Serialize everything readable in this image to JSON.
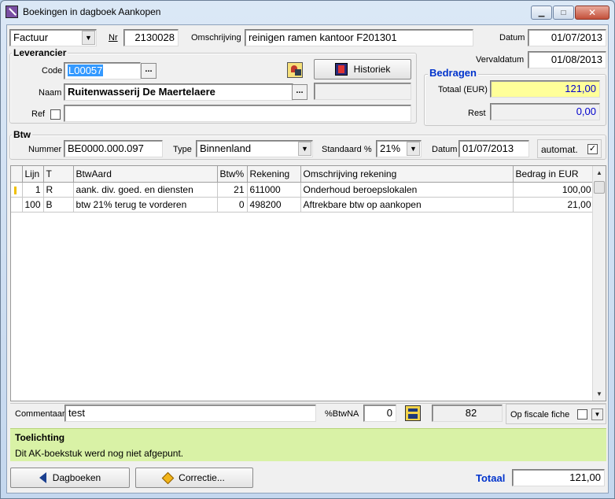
{
  "window": {
    "title": "Boekingen in dagboek Aankopen"
  },
  "header": {
    "doc_type": "Factuur",
    "nr_label": "Nr",
    "nr_value": "2130028",
    "omschrijving_label": "Omschrijving",
    "omschrijving_value": "reinigen ramen kantoor F201301",
    "datum_label": "Datum",
    "datum_value": "01/07/2013",
    "vervaldatum_label": "Vervaldatum",
    "vervaldatum_value": "01/08/2013"
  },
  "leverancier": {
    "title": "Leverancier",
    "code_label": "Code",
    "code_value": "L00057",
    "naam_label": "Naam",
    "naam_value": "Ruitenwasserij De Maertelaere",
    "ref_label": "Ref",
    "ref_value": "",
    "historiek_label": "Historiek",
    "dots": "..."
  },
  "bedragen": {
    "title": "Bedragen",
    "totaal_label": "Totaal (EUR)",
    "totaal_value": "121,00",
    "rest_label": "Rest",
    "rest_value": "0,00"
  },
  "btw": {
    "title": "Btw",
    "nummer_label": "Nummer",
    "nummer_value": "BE0000.000.097",
    "type_label": "Type",
    "type_value": "Binnenland",
    "standaard_label": "Standaard %",
    "standaard_value": "21%",
    "datum_label": "Datum",
    "datum_value": "01/07/2013",
    "automat_label": "automat.",
    "automat_checked": "✓"
  },
  "table": {
    "columns": [
      "Lijn",
      "T",
      "BtwAard",
      "Btw%",
      "Rekening",
      "Omschrijving rekening",
      "Bedrag in EUR"
    ],
    "rows": [
      [
        "1",
        "R",
        "aank. div. goed. en diensten",
        "21",
        "611000",
        "Onderhoud beroepslokalen",
        "100,00"
      ],
      [
        "100",
        "B",
        "btw 21% terug te vorderen",
        "0",
        "498200",
        "Aftrekbare btw op aankopen",
        "21,00"
      ]
    ]
  },
  "footer": {
    "commentaar_label": "Commentaar",
    "commentaar_value": "test",
    "btwna_label": "%BtwNA",
    "btwna_value": "0",
    "count_value": "82",
    "fiscale_label": "Op fiscale fiche",
    "toelichting_title": "Toelichting",
    "toelichting_text": "Dit AK-boekstuk werd nog niet afgepunt.",
    "dagboeken_label": "Dagboeken",
    "correctie_label": "Correctie...",
    "totaal_label": "Totaal",
    "totaal_value": "121,00"
  },
  "colors": {
    "accent_blue": "#0033cc",
    "info_green": "#d9f2a6",
    "highlight_yellow": "#ffff99"
  }
}
